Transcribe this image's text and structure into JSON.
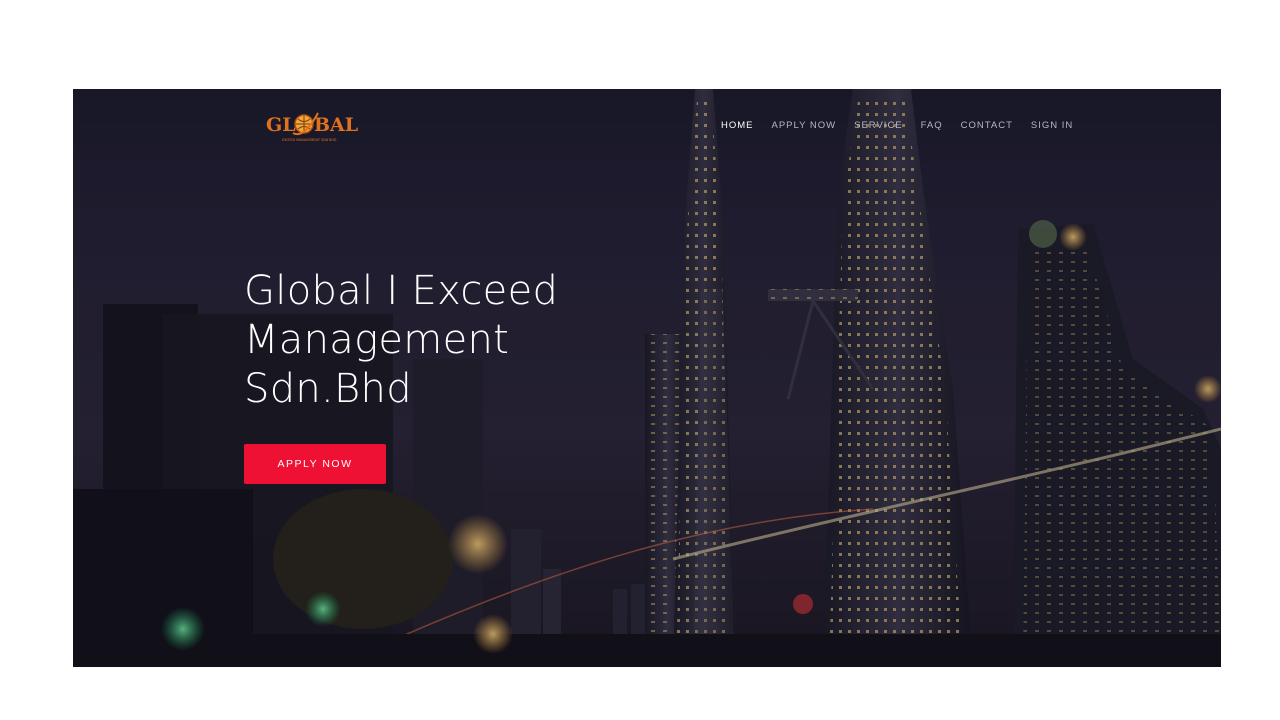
{
  "brand": {
    "logo_text": "GLOBAL",
    "logo_subtext": "EXCEED MANAGEMENT SDN BHD",
    "logo_color": "#e0711f"
  },
  "nav": {
    "items": [
      {
        "label": "HOME",
        "active": true
      },
      {
        "label": "APPLY NOW",
        "active": false
      },
      {
        "label": "SERVICE",
        "active": false
      },
      {
        "label": "FAQ",
        "active": false
      },
      {
        "label": "CONTACT",
        "active": false
      },
      {
        "label": "SIGN IN",
        "active": false
      }
    ]
  },
  "hero": {
    "title_lines": [
      "Global I Exceed",
      "Management",
      "Sdn.Bhd"
    ],
    "cta_label": "APPLY NOW",
    "cta_color": "#ee1133",
    "background_description_icon": "city-night-skyline-image"
  }
}
